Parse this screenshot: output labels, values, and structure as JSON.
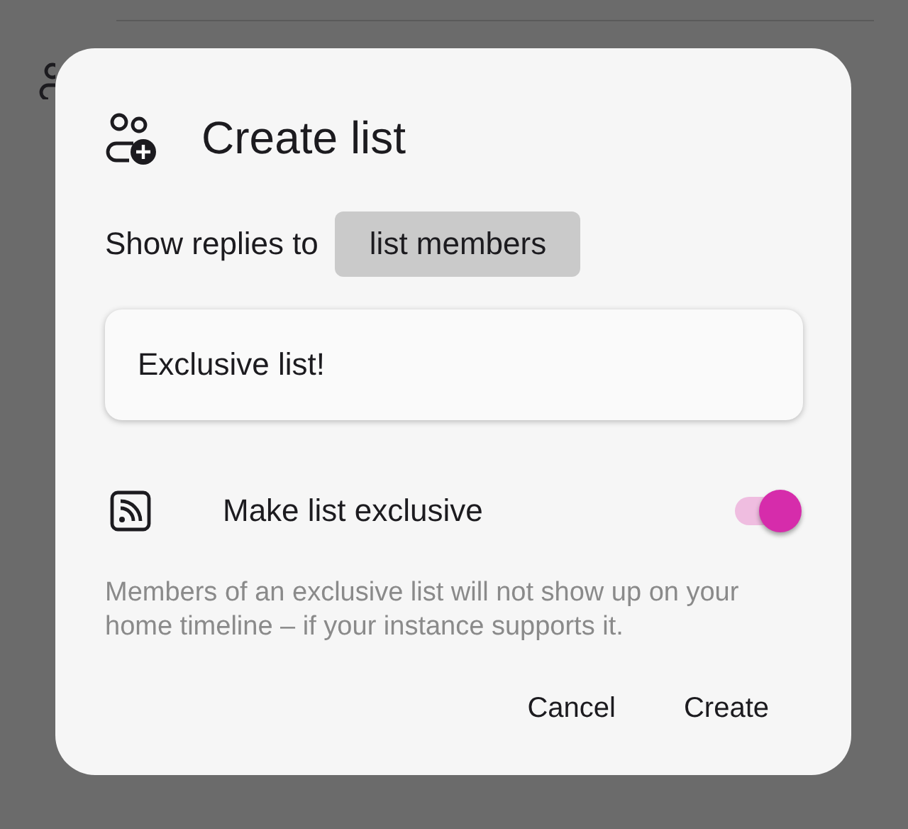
{
  "dialog": {
    "title": "Create list",
    "replies": {
      "label": "Show replies to",
      "value": "list members"
    },
    "name_field": {
      "value": "Exclusive list!"
    },
    "exclusive": {
      "label": "Make list exclusive",
      "on": true
    },
    "description": "Members of an exclusive list will not show up on your home timeline – if your instance supports it.",
    "buttons": [
      {
        "label": "Cancel"
      },
      {
        "label": "Create"
      }
    ]
  }
}
